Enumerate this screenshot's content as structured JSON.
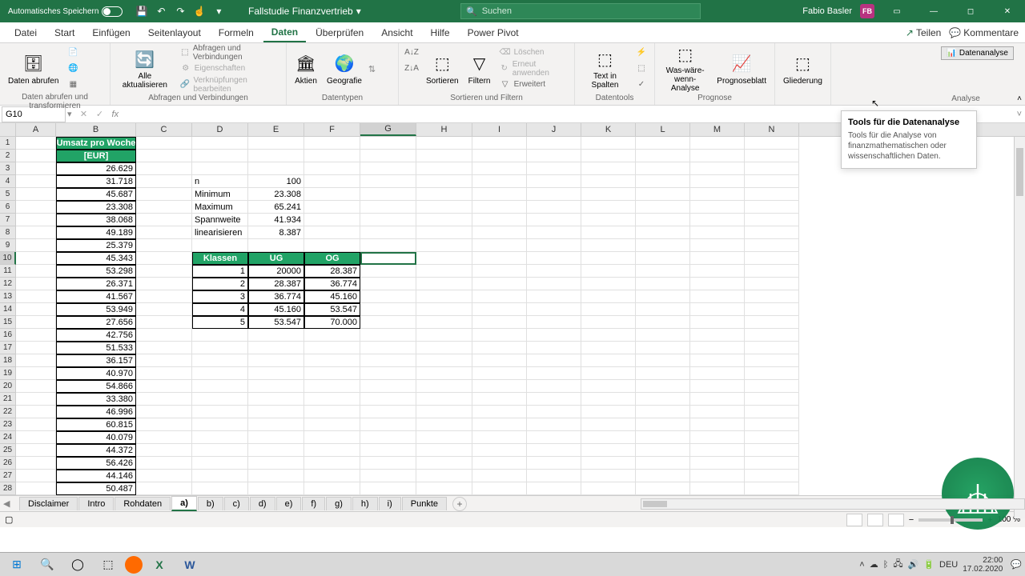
{
  "titlebar": {
    "autosave": "Automatisches Speichern",
    "doc_title": "Fallstudie Finanzvertrieb",
    "search_placeholder": "Suchen",
    "user_name": "Fabio Basler",
    "user_initials": "FB"
  },
  "tabs": {
    "datei": "Datei",
    "start": "Start",
    "einfuegen": "Einfügen",
    "seitenlayout": "Seitenlayout",
    "formeln": "Formeln",
    "daten": "Daten",
    "ueberpruefen": "Überprüfen",
    "ansicht": "Ansicht",
    "hilfe": "Hilfe",
    "powerpivot": "Power Pivot",
    "teilen": "Teilen",
    "kommentare": "Kommentare"
  },
  "ribbon": {
    "g1": {
      "daten_abrufen": "Daten\nabrufen",
      "label": "Daten abrufen und transformieren"
    },
    "g2": {
      "alle_akt": "Alle\naktualisieren",
      "q1": "Abfragen und Verbindungen",
      "q2": "Eigenschaften",
      "q3": "Verknüpfungen bearbeiten",
      "label": "Abfragen und Verbindungen"
    },
    "g3": {
      "aktien": "Aktien",
      "geografie": "Geografie",
      "label": "Datentypen"
    },
    "g4": {
      "sortieren": "Sortieren",
      "filtern": "Filtern",
      "loeschen": "Löschen",
      "erneut": "Erneut anwenden",
      "erweitert": "Erweitert",
      "label": "Sortieren und Filtern"
    },
    "g5": {
      "text_in_spalten": "Text in\nSpalten",
      "label": "Datentools"
    },
    "g6": {
      "was_waere": "Was-wäre-wenn-\nAnalyse",
      "prognose": "Prognoseblatt",
      "label": "Prognose"
    },
    "g7": {
      "gliederung": "Gliederung"
    },
    "g8": {
      "datenanalyse": "Datenanalyse",
      "label": "Analyse"
    }
  },
  "tooltip": {
    "title": "Tools für die Datenanalyse",
    "text": "Tools für die Analyse von finanzmathematischen oder wissenschaftlichen Daten."
  },
  "namebox": "G10",
  "columns": [
    "A",
    "B",
    "C",
    "D",
    "E",
    "F",
    "G",
    "H",
    "I",
    "J",
    "K",
    "L",
    "M",
    "N"
  ],
  "header_b": "Umsatz pro Woche [EUR]",
  "col_b_values": [
    "26.629",
    "31.718",
    "45.687",
    "23.308",
    "38.068",
    "49.189",
    "25.379",
    "45.343",
    "53.298",
    "26.371",
    "41.567",
    "53.949",
    "27.656",
    "42.756",
    "51.533",
    "36.157",
    "40.970",
    "54.866",
    "33.380",
    "46.996",
    "60.815",
    "40.079",
    "44.372",
    "56.426",
    "44.146",
    "50.487"
  ],
  "stats": [
    {
      "label": "n",
      "value": "100"
    },
    {
      "label": "Minimum",
      "value": "23.308"
    },
    {
      "label": "Maximum",
      "value": "65.241"
    },
    {
      "label": "Spannweite",
      "value": "41.934"
    },
    {
      "label": "linearisieren",
      "value": "8.387"
    }
  ],
  "class_headers": {
    "klassen": "Klassen",
    "ug": "UG",
    "og": "OG"
  },
  "classes": [
    {
      "k": "1",
      "ug": "20000",
      "og": "28.387"
    },
    {
      "k": "2",
      "ug": "28.387",
      "og": "36.774"
    },
    {
      "k": "3",
      "ug": "36.774",
      "og": "45.160"
    },
    {
      "k": "4",
      "ug": "45.160",
      "og": "53.547"
    },
    {
      "k": "5",
      "ug": "53.547",
      "og": "70.000"
    }
  ],
  "sheets": [
    "Disclaimer",
    "Intro",
    "Rohdaten",
    "a)",
    "b)",
    "c)",
    "d)",
    "e)",
    "f)",
    "g)",
    "h)",
    "i)",
    "Punkte"
  ],
  "active_sheet": 3,
  "zoom": "100 %",
  "tray": {
    "lang": "DEU",
    "time": "22:00",
    "date": "17.02.2020"
  }
}
